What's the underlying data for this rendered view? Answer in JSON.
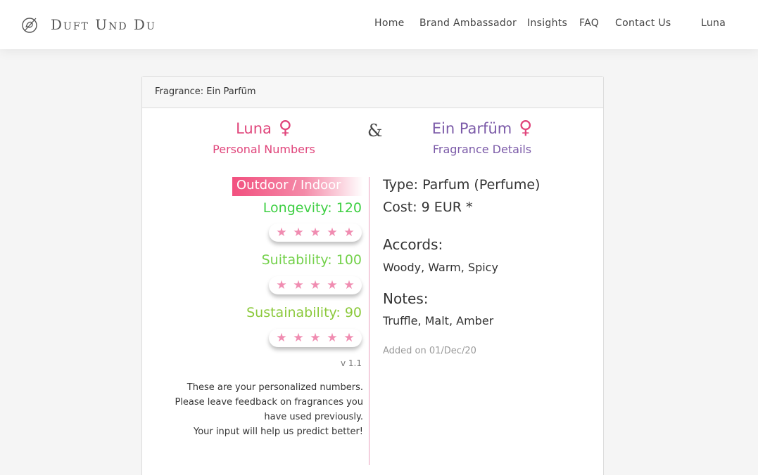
{
  "brand": {
    "name": "Duft Und Du",
    "logo_icon": "perfume-monogram-icon"
  },
  "nav": {
    "home": "Home",
    "brand_ambassador": "Brand Ambassador",
    "insights": "Insights",
    "faq": "FAQ",
    "contact": "Contact Us",
    "user": "Luna"
  },
  "card": {
    "header": "Fragrance: Ein Parfüm",
    "user": {
      "name": "Luna",
      "gender_icon": "female-symbol-icon",
      "gender_symbol": "♀",
      "subtitle": "Personal Numbers"
    },
    "ampersand": "&",
    "fragrance": {
      "name": "Ein Parfüm",
      "gender_icon": "female-symbol-icon",
      "gender_symbol": "♀",
      "subtitle": "Fragrance Details"
    },
    "mode": "Outdoor / Indoor",
    "metrics": [
      {
        "label": "Longevity: 120",
        "stars_filled": 0,
        "stars_total": 5
      },
      {
        "label": "Suitability: 100",
        "stars_filled": 0,
        "stars_total": 5
      },
      {
        "label": "Sustainability: 90",
        "stars_filled": 0,
        "stars_total": 5
      }
    ],
    "star_glyph": "★",
    "version": "v 1.1",
    "help": [
      "These are your personalized numbers.",
      "Please leave feedback on fragrances you",
      "have used previously.",
      "Your input will help us predict better!"
    ],
    "details": {
      "type": "Type: Parfum (Perfume)",
      "cost": "Cost: 9 EUR *",
      "accords_heading": "Accords:",
      "accords": "Woody, Warm, Spicy",
      "notes_heading": "Notes:",
      "notes": "Truffle, Malt, Amber",
      "added": "Added on 01/Dec/20"
    }
  },
  "colors": {
    "user_accent": "#e0457b",
    "fragrance_accent": "#7b5aa8",
    "star": "#f08cb1",
    "longevity": "#3ecf43",
    "suitability": "#74d14b",
    "sustainability": "#8bc93b"
  }
}
